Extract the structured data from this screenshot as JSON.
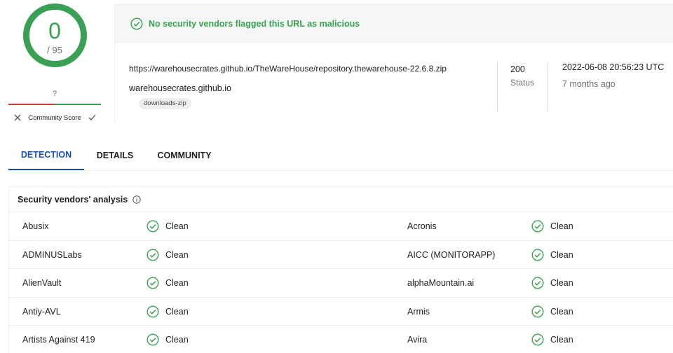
{
  "score": {
    "detections": "0",
    "total": "/ 95",
    "community_question": "?",
    "community_label": "Community Score"
  },
  "banner": {
    "text": "No security vendors flagged this URL as malicious"
  },
  "details": {
    "url": "https://warehousecrates.github.io/TheWareHouse/repository.thewarehouse-22.6.8.zip",
    "domain": "warehousecrates.github.io",
    "tag": "downloads-zip",
    "status_code": "200",
    "status_label": "Status",
    "datetime": "2022-06-08 20:56:23 UTC",
    "relative_time": "7 months ago"
  },
  "tabs": [
    {
      "label": "DETECTION"
    },
    {
      "label": "DETAILS"
    },
    {
      "label": "COMMUNITY"
    }
  ],
  "vendors": {
    "title": "Security vendors' analysis",
    "rows": [
      {
        "left": {
          "name": "Abusix",
          "result": "Clean"
        },
        "right": {
          "name": "Acronis",
          "result": "Clean"
        }
      },
      {
        "left": {
          "name": "ADMINUSLabs",
          "result": "Clean"
        },
        "right": {
          "name": "AICC (MONITORAPP)",
          "result": "Clean"
        }
      },
      {
        "left": {
          "name": "AlienVault",
          "result": "Clean"
        },
        "right": {
          "name": "alphaMountain.ai",
          "result": "Clean"
        }
      },
      {
        "left": {
          "name": "Antiy-AVL",
          "result": "Clean"
        },
        "right": {
          "name": "Armis",
          "result": "Clean"
        }
      },
      {
        "left": {
          "name": "Artists Against 419",
          "result": "Clean"
        },
        "right": {
          "name": "Avira",
          "result": "Clean"
        }
      }
    ]
  },
  "colors": {
    "clean_green": "#3aa154",
    "accent_blue": "#1b4ea8",
    "malicious_red": "#d13b3b"
  }
}
